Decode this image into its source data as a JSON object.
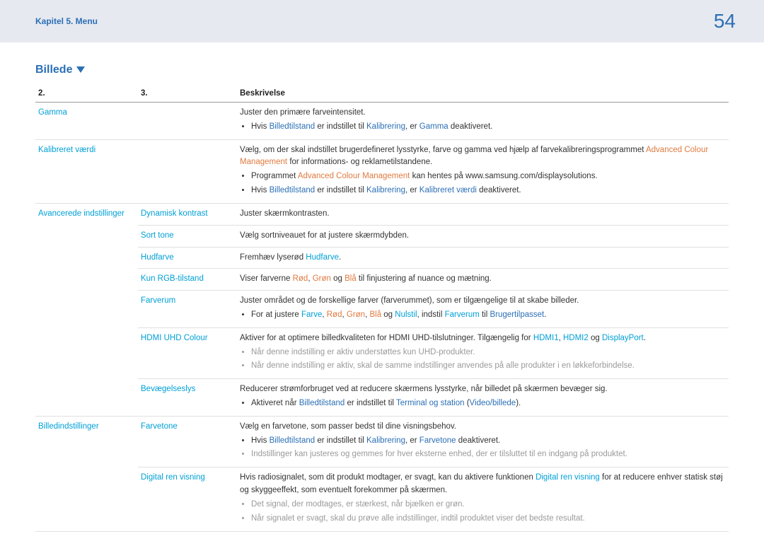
{
  "header": {
    "chapter": "Kapitel 5. Menu",
    "page": "54"
  },
  "section": {
    "title": "Billede"
  },
  "table": {
    "headers": {
      "c1": "2.",
      "c2": "3.",
      "c3": "Beskrivelse"
    },
    "gamma": {
      "name": "Gamma",
      "desc": "Juster den primære farveintensitet.",
      "b1_pre": "Hvis ",
      "b1_t1": "Billedtilstand",
      "b1_mid1": " er indstillet til ",
      "b1_t2": "Kalibrering",
      "b1_mid2": ", er ",
      "b1_t3": "Gamma",
      "b1_post": " deaktiveret."
    },
    "kalibreret": {
      "name": "Kalibreret værdi",
      "d_pre": "Vælg, om der skal indstillet brugerdefineret lysstyrke, farve og gamma ved hjælp af farvekalibreringsprogrammet ",
      "d_t1": "Advanced Colour Management",
      "d_post": " for informations- og reklametilstandene.",
      "b1_pre": "Programmet ",
      "b1_t1": "Advanced Colour Management",
      "b1_post": " kan hentes på www.samsung.com/displaysolutions.",
      "b2_pre": "Hvis ",
      "b2_t1": "Billedtilstand",
      "b2_mid1": " er indstillet til ",
      "b2_t2": "Kalibrering",
      "b2_mid2": ", er ",
      "b2_t3": "Kalibreret værdi",
      "b2_post": " deaktiveret."
    },
    "adv": {
      "name": "Avancerede indstillinger"
    },
    "dyn": {
      "name": "Dynamisk kontrast",
      "desc": "Juster skærmkontrasten."
    },
    "sort": {
      "name": "Sort tone",
      "desc": "Vælg sortniveauet for at justere skærmdybden."
    },
    "hud": {
      "name": "Hudfarve",
      "d_pre": "Fremhæv lyserød ",
      "d_t1": "Hudfarve",
      "d_post": "."
    },
    "rgb": {
      "name": "Kun RGB-tilstand",
      "d_pre": "Viser farverne ",
      "rd": "Rød",
      "sep1": ", ",
      "gr": "Grøn",
      "sep2": " og ",
      "bl": "Blå",
      "d_post": " til finjustering af nuance og mætning."
    },
    "farverum": {
      "name": "Farverum",
      "desc": "Juster området og de forskellige farver (farverummet), som er tilgængelige til at skabe billeder.",
      "b1_pre": "For at justere ",
      "b1_t1": "Farve",
      "sep1": ", ",
      "b1_t2": "Rød",
      "sep2": ", ",
      "b1_t3": "Grøn",
      "sep3": ", ",
      "b1_t4": "Blå",
      "sep4": " og ",
      "b1_t5": "Nulstil",
      "b1_mid": ", indstil ",
      "b1_t6": "Farverum",
      "b1_mid2": " til ",
      "b1_t7": "Brugertilpasset",
      "b1_post": "."
    },
    "uhd": {
      "name": "HDMI UHD Colour",
      "d_pre": "Aktiver for at optimere billedkvaliteten for HDMI UHD-tilslutninger. Tilgængelig for ",
      "h1": "HDMI1",
      "sep1": ", ",
      "h2": "HDMI2",
      "sep2": " og ",
      "dp": "DisplayPort",
      "d_post": ".",
      "b1": "Når denne indstilling er aktiv understøttes kun UHD-produkter.",
      "b2": "Når denne indstilling er aktiv, skal de samme indstillinger anvendes på alle produkter i en løkkeforbindelse."
    },
    "bevaeg": {
      "name": "Bevægelseslys",
      "desc": "Reducerer strømforbruget ved at reducere skærmens lysstyrke, når billedet på skærmen bevæger sig.",
      "b1_pre": "Aktiveret når ",
      "b1_t1": "Billedtilstand",
      "b1_mid": " er indstillet til ",
      "b1_t2": "Terminal og station",
      "b1_sep": " (",
      "b1_t3": "Video/billede",
      "b1_post": ")."
    },
    "billedind": {
      "name": "Billedindstillinger"
    },
    "farvetone": {
      "name": "Farvetone",
      "desc": "Vælg en farvetone, som passer bedst til dine visningsbehov.",
      "b1_pre": "Hvis ",
      "b1_t1": "Billedtilstand",
      "b1_mid1": " er indstillet til ",
      "b1_t2": "Kalibrering",
      "b1_mid2": ", er ",
      "b1_t3": "Farvetone",
      "b1_post": " deaktiveret.",
      "b2": "Indstillinger kan justeres og gemmes for hver eksterne enhed, der er tilsluttet til en indgang på produktet."
    },
    "digital": {
      "name": "Digital ren visning",
      "d_pre": "Hvis radiosignalet, som dit produkt modtager, er svagt, kan du aktivere funktionen ",
      "d_t1": "Digital ren visning",
      "d_post": " for at reducere enhver statisk støj og skyggeeffekt, som eventuelt forekommer på skærmen.",
      "b1": "Det signal, der modtages, er stærkest, når bjælken er grøn.",
      "b2": "Når signalet er svagt, skal du prøve alle indstillinger, indtil produktet viser det bedste resultat."
    }
  }
}
